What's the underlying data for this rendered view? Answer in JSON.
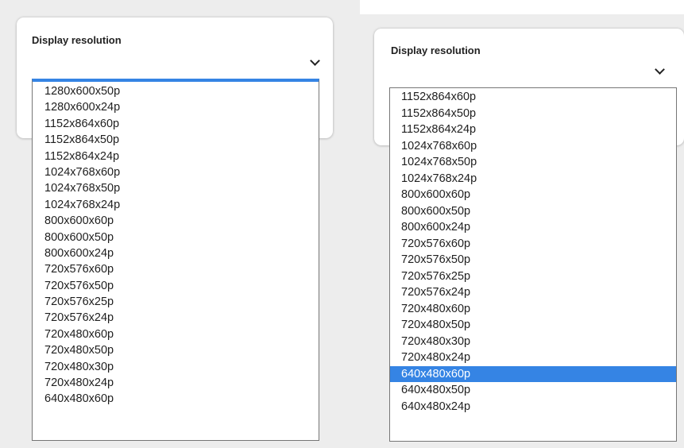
{
  "left_panel": {
    "label": "Display resolution",
    "options": [
      "1280x600x50p",
      "1280x600x24p",
      "1152x864x60p",
      "1152x864x50p",
      "1152x864x24p",
      "1024x768x60p",
      "1024x768x50p",
      "1024x768x24p",
      "800x600x60p",
      "800x600x50p",
      "800x600x24p",
      "720x576x60p",
      "720x576x50p",
      "720x576x25p",
      "720x576x24p",
      "720x480x60p",
      "720x480x50p",
      "720x480x30p",
      "720x480x24p",
      "640x480x60p"
    ]
  },
  "right_panel": {
    "label": "Display resolution",
    "highlighted": "640x480x60p",
    "options": [
      "1152x864x60p",
      "1152x864x50p",
      "1152x864x24p",
      "1024x768x60p",
      "1024x768x50p",
      "1024x768x24p",
      "800x600x60p",
      "800x600x50p",
      "800x600x24p",
      "720x576x60p",
      "720x576x50p",
      "720x576x25p",
      "720x576x24p",
      "720x480x60p",
      "720x480x50p",
      "720x480x30p",
      "720x480x24p",
      "640x480x60p",
      "640x480x50p",
      "640x480x24p"
    ]
  },
  "colors": {
    "highlight": "#3584e4",
    "background": "#ededed"
  },
  "icons": {
    "dropdown_toggle": "chevron-down-icon"
  }
}
